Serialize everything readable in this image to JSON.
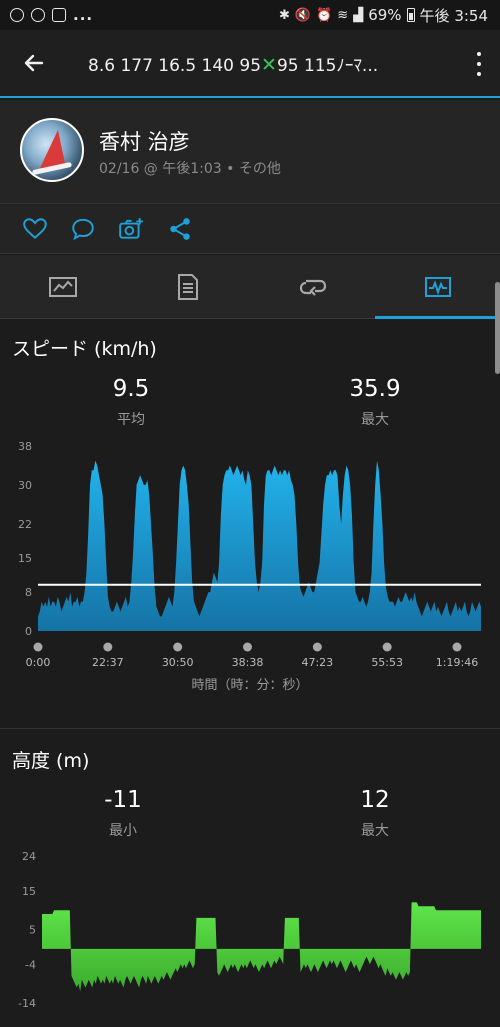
{
  "status": {
    "battery": "69%",
    "time": "午後 3:54",
    "dots": "..."
  },
  "appbar": {
    "title_before": "8.6 177 16.5 140 95",
    "title_x": "✕",
    "title_after": "95 115ﾉｰﾏ..."
  },
  "profile": {
    "name": "香村 治彦",
    "meta": "02/16 @ 午後1:03 • その他"
  },
  "actions": {
    "icons": [
      "heart-icon",
      "comment-icon",
      "add-photo-icon",
      "share-icon"
    ]
  },
  "tabs": {
    "icons": [
      "overview-icon",
      "details-icon",
      "laps-icon",
      "charts-icon"
    ],
    "active": 3
  },
  "speed": {
    "title": "スピード (km/h)",
    "avg_value": "9.5",
    "avg_label": "平均",
    "max_value": "35.9",
    "max_label": "最大",
    "x_title": "時間（時：分：秒）"
  },
  "elevation": {
    "title": "高度 (m)",
    "min_value": "-11",
    "min_label": "最小",
    "max_value": "12",
    "max_label": "最大"
  },
  "colors": {
    "accent": "#1fa0d8",
    "speed_fill": "#1e9ad6",
    "elev_fill": "#4cd137",
    "background": "#1c1c1c"
  },
  "chart_data": [
    {
      "type": "area",
      "yticks": [
        0,
        8,
        15,
        22,
        30,
        38
      ],
      "ylim": [
        0,
        38
      ],
      "xticks": [
        "0:00",
        "22:37",
        "30:50",
        "38:38",
        "47:23",
        "55:53",
        "1:19:46"
      ],
      "avg_line": 9.5,
      "series": [
        {
          "values": [
            3,
            4,
            6,
            5,
            6,
            5,
            7,
            5,
            6,
            6,
            5,
            7,
            6,
            4,
            5,
            6,
            7,
            6,
            8,
            5,
            6,
            6,
            7,
            5,
            6,
            6,
            8,
            12,
            20,
            30,
            33,
            33,
            35,
            34,
            32,
            30,
            28,
            22,
            14,
            7,
            5,
            4,
            4,
            5,
            6,
            5,
            4,
            5,
            6,
            7,
            5,
            6,
            10,
            16,
            24,
            30,
            31,
            32,
            31,
            30,
            30,
            31,
            28,
            22,
            16,
            9,
            5,
            4,
            3,
            3,
            4,
            5,
            6,
            7,
            6,
            5,
            8,
            14,
            22,
            30,
            33,
            34,
            33,
            30,
            26,
            18,
            10,
            6,
            5,
            4,
            3,
            4,
            5,
            6,
            7,
            8,
            8,
            10,
            12,
            11,
            10,
            14,
            24,
            30,
            32,
            33,
            33,
            34,
            33,
            32,
            33,
            34,
            33,
            32,
            33,
            31,
            30,
            33,
            32,
            30,
            22,
            14,
            10,
            8,
            10,
            14,
            26,
            32,
            33,
            33,
            32,
            33,
            34,
            33,
            32,
            33,
            32,
            33,
            33,
            32,
            33,
            31,
            30,
            28,
            22,
            14,
            9,
            8,
            7,
            8,
            9,
            10,
            9,
            8,
            8,
            10,
            12,
            14,
            20,
            26,
            30,
            32,
            32,
            33,
            32,
            33,
            33,
            32,
            26,
            22,
            28,
            32,
            34,
            33,
            30,
            24,
            14,
            8,
            7,
            6,
            6,
            7,
            6,
            5,
            6,
            8,
            12,
            22,
            30,
            35,
            33,
            28,
            22,
            14,
            9,
            7,
            6,
            6,
            6,
            5,
            6,
            7,
            6,
            6,
            7,
            8,
            7,
            6,
            7,
            6,
            8,
            6,
            5,
            4,
            3,
            4,
            5,
            6,
            5,
            4,
            5,
            6,
            4,
            5,
            4,
            3,
            4,
            5,
            6,
            4,
            3,
            4,
            5,
            6,
            4,
            5,
            4,
            5,
            6,
            4,
            3,
            4,
            6,
            5,
            4,
            5,
            6,
            5
          ]
        }
      ]
    },
    {
      "type": "area",
      "yticks": [
        -14,
        -4,
        5,
        15,
        24
      ],
      "ylim": [
        -14,
        24
      ],
      "series": [
        {
          "values": [
            9,
            9,
            9,
            9,
            9,
            9,
            9,
            10,
            10,
            10,
            10,
            10,
            10,
            10,
            10,
            10,
            10,
            -7,
            -8,
            -9,
            -10,
            -9,
            -11,
            -8,
            -9,
            -10,
            -9,
            -8,
            -9,
            -10,
            -8,
            -9,
            -7,
            -8,
            -9,
            -8,
            -9,
            -7,
            -8,
            -9,
            -8,
            -9,
            -7,
            -8,
            -9,
            -8,
            -9,
            -10,
            -8,
            -7,
            -8,
            -9,
            -8,
            -7,
            -8,
            -9,
            -10,
            -8,
            -7,
            -8,
            -9,
            -7,
            -8,
            -9,
            -8,
            -7,
            -8,
            -9,
            -8,
            -7,
            -8,
            -7,
            -6,
            -7,
            -8,
            -7,
            -6,
            -5,
            -6,
            -5,
            -4,
            -5,
            -4,
            -5,
            -4,
            -3,
            -4,
            -5,
            -4,
            8,
            8,
            8,
            8,
            8,
            8,
            8,
            8,
            8,
            8,
            8,
            8,
            -6,
            -7,
            -6,
            -5,
            -4,
            -5,
            -6,
            -5,
            -4,
            -5,
            -4,
            -5,
            -6,
            -5,
            -4,
            -5,
            -4,
            -5,
            -4,
            -3,
            -4,
            -5,
            -4,
            -5,
            -6,
            -5,
            -4,
            -5,
            -4,
            -3,
            -4,
            -5,
            -4,
            -3,
            -4,
            -3,
            -2,
            -3,
            -4,
            8,
            8,
            8,
            8,
            8,
            8,
            8,
            8,
            8,
            -6,
            -5,
            -4,
            -5,
            -4,
            -5,
            -6,
            -5,
            -4,
            -5,
            -6,
            -5,
            -4,
            -3,
            -4,
            -5,
            -4,
            -3,
            -4,
            -3,
            -4,
            -5,
            -4,
            -3,
            -4,
            -5,
            -6,
            -5,
            -4,
            -3,
            -4,
            -5,
            -4,
            -5,
            -6,
            -5,
            -4,
            -3,
            -2,
            -3,
            -4,
            -3,
            -2,
            -3,
            -4,
            -5,
            -4,
            -5,
            -6,
            -7,
            -5,
            -6,
            -7,
            -6,
            -7,
            -8,
            -7,
            -6,
            -7,
            -8,
            -7,
            -6,
            -7,
            -6,
            12,
            12,
            12,
            12,
            11,
            11,
            11,
            11,
            11,
            11,
            11,
            11,
            11,
            11,
            10,
            10,
            10,
            10,
            10,
            10,
            10,
            10,
            10,
            10,
            10,
            10,
            10,
            10,
            10,
            10,
            10,
            10,
            10,
            10,
            10,
            10,
            10,
            10,
            10,
            10,
            10
          ]
        }
      ]
    }
  ]
}
